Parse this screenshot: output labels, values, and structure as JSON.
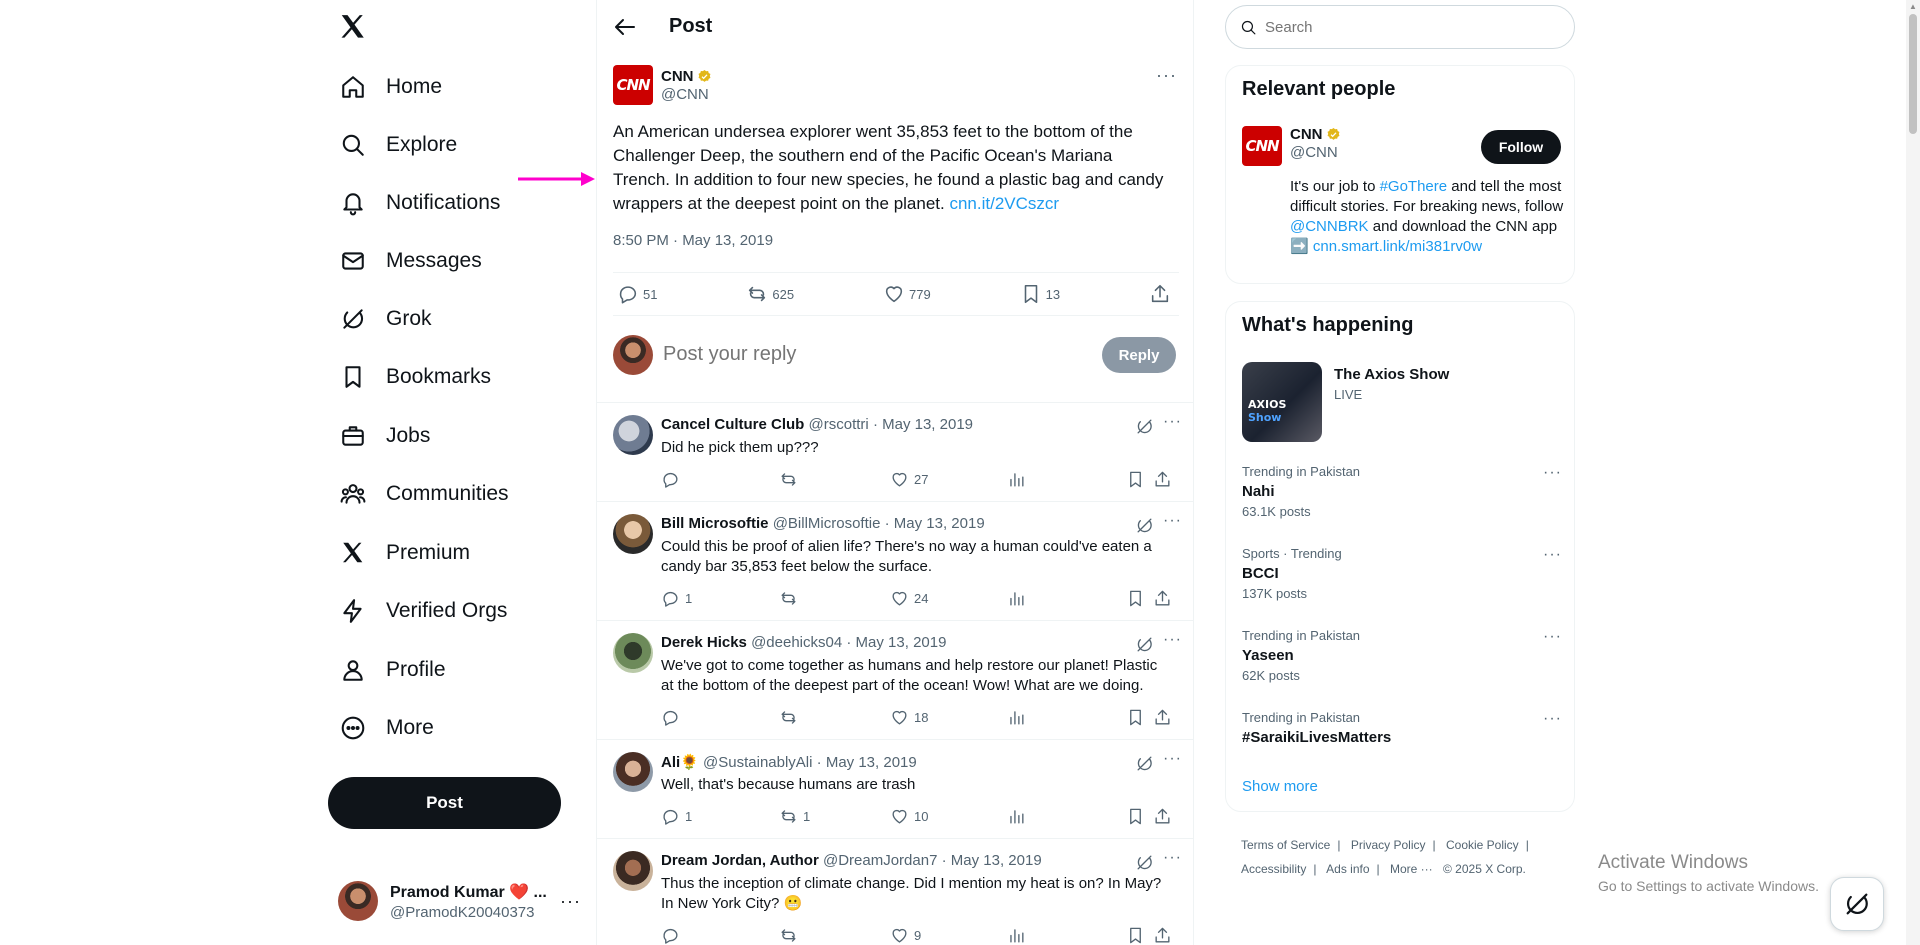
{
  "nav": {
    "items": [
      {
        "label": "Home",
        "icon": "home-icon"
      },
      {
        "label": "Explore",
        "icon": "search-icon"
      },
      {
        "label": "Notifications",
        "icon": "bell-icon"
      },
      {
        "label": "Messages",
        "icon": "mail-icon"
      },
      {
        "label": "Grok",
        "icon": "grok-icon"
      },
      {
        "label": "Bookmarks",
        "icon": "bookmark-icon"
      },
      {
        "label": "Jobs",
        "icon": "briefcase-icon"
      },
      {
        "label": "Communities",
        "icon": "communities-icon"
      },
      {
        "label": "Premium",
        "icon": "x-logo-icon"
      },
      {
        "label": "Verified Orgs",
        "icon": "lightning-icon"
      },
      {
        "label": "Profile",
        "icon": "person-icon"
      },
      {
        "label": "More",
        "icon": "more-circle-icon"
      }
    ],
    "post_label": "Post",
    "account": {
      "name": "Pramod Kumar ❤️ ...",
      "handle": "@PramodK20040373"
    }
  },
  "header": {
    "title": "Post"
  },
  "tweet": {
    "author_name": "CNN",
    "author_handle": "@CNN",
    "logo_text": "CNN",
    "text": "An American undersea explorer went 35,853 feet to the bottom of the Challenger Deep, the southern end of the Pacific Ocean's Mariana Trench. In addition to four new species, he found a plastic bag and candy wrappers at the deepest point on the planet. ",
    "link": "cnn.it/2VCszcr",
    "timestamp": "8:50 PM · May 13, 2019",
    "stats": {
      "replies": "51",
      "reposts": "625",
      "likes": "779",
      "bookmarks": "13"
    }
  },
  "reply_composer": {
    "placeholder": "Post your reply",
    "button": "Reply"
  },
  "replies": [
    {
      "name": "Cancel Culture Club",
      "handle": "@rscottri",
      "date": "May 13, 2019",
      "text": "Did he pick them up???",
      "replies": "",
      "reposts": "",
      "likes": "27"
    },
    {
      "name": "Bill Microsoftie",
      "handle": "@BillMicrosoftie",
      "date": "May 13, 2019",
      "text": "Could this be proof of alien life? There's no way a human could've eaten a candy bar 35,853 feet below the surface.",
      "replies": "1",
      "reposts": "",
      "likes": "24"
    },
    {
      "name": "Derek Hicks",
      "handle": "@deehicks04",
      "date": "May 13, 2019",
      "text": "We've got to come together as humans and help restore our planet!  Plastic at the bottom of the deepest part of the ocean!  Wow!  What are we doing.",
      "replies": "",
      "reposts": "",
      "likes": "18"
    },
    {
      "name": "Ali🌻",
      "handle": "@SustainablyAli",
      "date": "May 13, 2019",
      "text": "Well, that's because humans are trash",
      "replies": "1",
      "reposts": "1",
      "likes": "10"
    },
    {
      "name": "Dream Jordan, Author",
      "handle": "@DreamJordan7",
      "date": "May 13, 2019",
      "text": "Thus the inception of climate change. Did I mention my heat is on? In May? In New York City? 😬",
      "replies": "",
      "reposts": "",
      "likes": "9"
    }
  ],
  "sidebar": {
    "search_placeholder": "Search",
    "relevant": {
      "title": "Relevant people",
      "name": "CNN",
      "handle": "@CNN",
      "follow": "Follow",
      "bio_1": "It's our job to ",
      "bio_tag": "#GoThere",
      "bio_2": " and tell the most difficult stories. For breaking news, follow ",
      "bio_mention": "@CNNBRK",
      "bio_3": " and download the CNN app ➡️ ",
      "bio_link": "cnn.smart.link/mi381rv0w"
    },
    "happening": {
      "title": "What's happening",
      "featured": {
        "title": "The Axios Show",
        "status": "LIVE",
        "thumb_word": "AXIOS",
        "thumb_word2": "Show"
      },
      "trends": [
        {
          "context": "Trending in Pakistan",
          "topic": "Nahi",
          "count": "63.1K posts"
        },
        {
          "context": "Sports · Trending",
          "topic": "BCCI",
          "count": "137K posts"
        },
        {
          "context": "Trending in Pakistan",
          "topic": "Yaseen",
          "count": "62K posts"
        },
        {
          "context": "Trending in Pakistan",
          "topic": "#SaraikiLivesMatters",
          "count": ""
        }
      ],
      "show_more": "Show more"
    },
    "footer": [
      "Terms of Service",
      "|",
      "Privacy Policy",
      "|",
      "Cookie Policy",
      "|",
      "Accessibility",
      "|",
      "Ads info",
      "|",
      "More ···",
      "© 2025 X Corp."
    ]
  },
  "os": {
    "activate_title": "Activate Windows",
    "activate_sub": "Go to Settings to activate Windows."
  },
  "colors": {
    "accent": "#1d9bf0",
    "cnn_red": "#cc0000",
    "annotation": "#ff00cc",
    "verified_gold": "#e2b719"
  }
}
